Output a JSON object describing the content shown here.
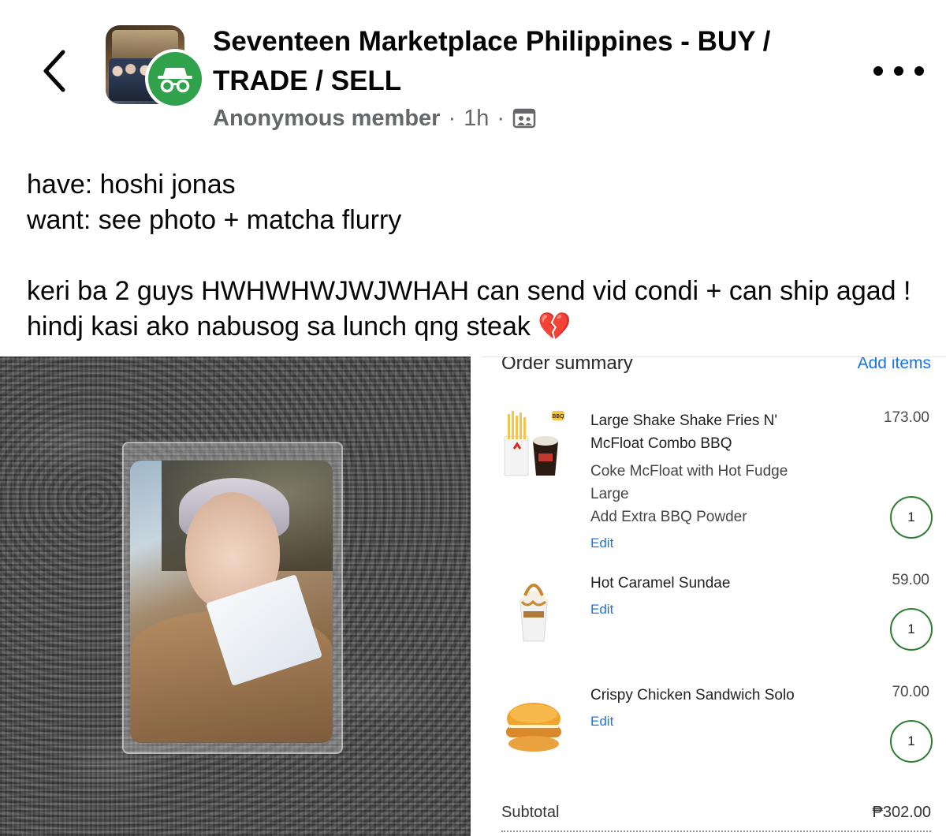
{
  "header": {
    "group_name": "Seventeen Marketplace Philippines - BUY / TRADE / SELL",
    "author": "Anonymous member",
    "time": "1h",
    "separator": "·"
  },
  "post": {
    "line1": "have: hoshi jonas",
    "line2": "want: see photo + matcha flurry",
    "line3": "keri ba 2 guys HWHWHWJWJWHAH can send vid condi + can ship agad ! hindj kasi ako nabusog sa lunch qng steak 💔"
  },
  "order_summary": {
    "title": "Order summary",
    "add_items": "Add items",
    "items": [
      {
        "name": "Large Shake Shake Fries N' McFloat Combo BBQ",
        "options": [
          "Coke McFloat with Hot Fudge",
          "Large",
          "Add Extra BBQ Powder"
        ],
        "price": "173.00",
        "qty": "1",
        "edit": "Edit",
        "badge": "BBQ"
      },
      {
        "name": "Hot Caramel Sundae",
        "price": "59.00",
        "qty": "1",
        "edit": "Edit"
      },
      {
        "name": "Crispy Chicken Sandwich Solo",
        "price": "70.00",
        "qty": "1",
        "edit": "Edit"
      }
    ],
    "subtotal_label": "Subtotal",
    "subtotal_value": "₱302.00"
  },
  "icons": {
    "back": "chevron-left-icon",
    "more": "more-dots-icon",
    "anonymous": "incognito-icon",
    "audience": "group-members-icon"
  },
  "colors": {
    "anon_green": "#31a24c",
    "link_blue": "#1a73e8",
    "qty_border": "#2e7d32",
    "meta_gray": "#65676b"
  }
}
